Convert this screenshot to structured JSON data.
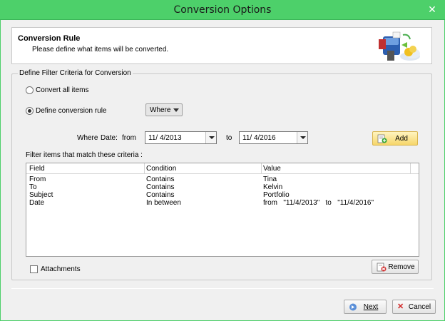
{
  "window": {
    "title": "Conversion Options",
    "close_glyph": "✕"
  },
  "header": {
    "title": "Conversion Rule",
    "subtitle": "Please define what items will be converted."
  },
  "filter_group": {
    "legend": "Define Filter Criteria for Conversion",
    "convert_all_label": "Convert all items",
    "define_rule_label": "Define conversion rule",
    "selected_option": "define_rule",
    "rule_dropdown_value": "Where",
    "where_label": "Where",
    "date_label": "Date:",
    "from_label": "from",
    "from_date": "11/ 4/2013",
    "to_label": "to",
    "to_date": "11/ 4/2016",
    "add_button": "Add",
    "criteria_label": "Filter items that match these criteria :",
    "columns": [
      "Field",
      "Condition",
      "Value"
    ],
    "rows": [
      {
        "field": "From",
        "condition": "Contains",
        "value": "Tina"
      },
      {
        "field": "To",
        "condition": "Contains",
        "value": "Kelvin"
      },
      {
        "field": "Subject",
        "condition": "Contains",
        "value": "Portfolio"
      },
      {
        "field": "Date",
        "condition": "In between",
        "value": "from   \"11/4/2013\"   to   \"11/4/2016\""
      }
    ],
    "attachments_label": "Attachments",
    "attachments_checked": false,
    "remove_button": "Remove"
  },
  "footer": {
    "next_button": "Next",
    "cancel_button": "Cancel"
  },
  "colors": {
    "titlebar": "#4dd06a",
    "add_button": "#f6d66a",
    "cancel_icon": "#d02020"
  }
}
